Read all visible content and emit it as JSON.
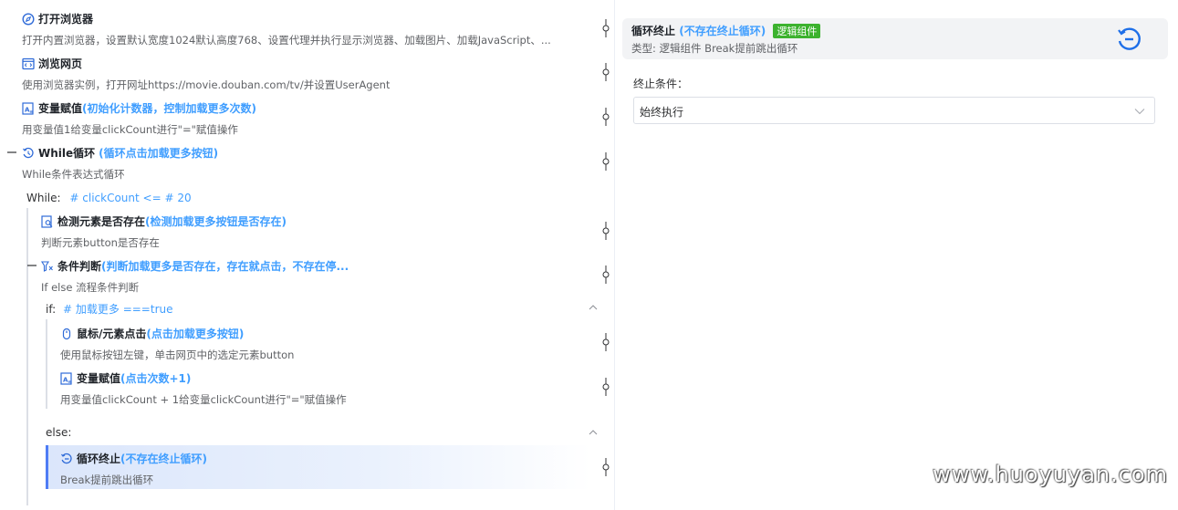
{
  "steps": [
    {
      "title": "打开浏览器",
      "note": "",
      "desc": "打开内置浏览器，设置默认宽度1024默认高度768、设置代理并执行显示浏览器、加载图片、加载JavaScript、...",
      "icon": "compass-icon"
    },
    {
      "title": "浏览网页",
      "note": "",
      "desc": "使用浏览器实例，打开网址https://movie.douban.com/tv/并设置UserAgent",
      "icon": "code-window-icon"
    },
    {
      "title": "变量赋值",
      "note": "(初始化计数器，控制加载更多次数)",
      "desc": "用变量值1给变量clickCount进行\"=\"赋值操作",
      "icon": "variable-assign-icon"
    },
    {
      "title": "While循环",
      "note": "(循环点击加载更多按钮)",
      "desc": "While条件表达式循环",
      "icon": "loop-icon"
    },
    {
      "title": "检测元素是否存在",
      "note": "(检测加载更多按钮是否存在)",
      "desc": "判断元素button是否存在",
      "icon": "element-check-icon"
    },
    {
      "title": "条件判断",
      "note": "(判断加载更多是否存在，存在就点击，不存在停...",
      "desc": "If else 流程条件判断",
      "icon": "condition-icon"
    },
    {
      "title": "鼠标/元素点击",
      "note": "(点击加载更多按钮)",
      "desc": "使用鼠标按钮左键，单击网页中的选定元素button",
      "icon": "mouse-icon"
    },
    {
      "title": "变量赋值",
      "note": "(点击次数+1)",
      "desc": "用变量值clickCount + 1给变量clickCount进行\"=\"赋值操作",
      "icon": "variable-assign-icon"
    },
    {
      "title": "循环终止",
      "note": "(不存在终止循环)",
      "desc": "Break提前跳出循环",
      "icon": "loop-break-icon"
    }
  ],
  "while_block": {
    "label": "While:",
    "expr": "# clickCount <= # 20"
  },
  "if_block": {
    "label": "if:",
    "expr": "# 加载更多 ===true"
  },
  "else_block": {
    "label": "else:"
  },
  "detail": {
    "title": "循环终止",
    "note": "(不存在终止循环)",
    "tag": "逻辑组件",
    "type_line": "类型:  逻辑组件 Break提前跳出循环",
    "field_label": "终止条件：",
    "select_value": "始终执行"
  },
  "watermark": "www.huoyuyan.com",
  "colors": {
    "accent": "#409eff",
    "tag_green": "#3cb22e",
    "selected_bg": "#dbe6fb"
  }
}
